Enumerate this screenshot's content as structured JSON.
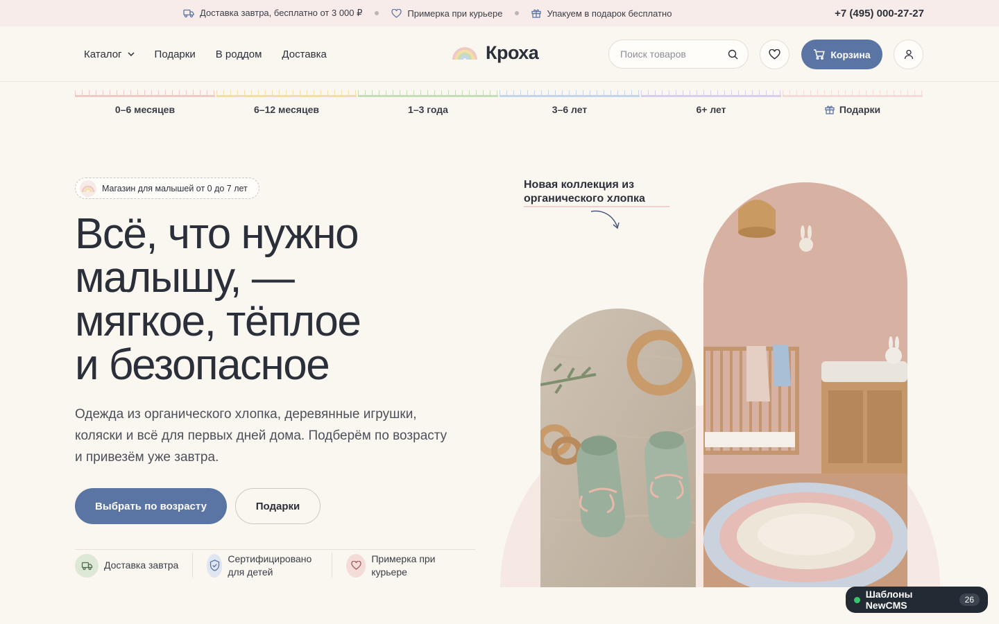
{
  "topbar": {
    "items": [
      {
        "icon": "truck-icon",
        "text": "Доставка завтра, бесплатно от 3 000 ₽"
      },
      {
        "icon": "heart-icon",
        "text": "Примерка при курьере"
      },
      {
        "icon": "gift-icon",
        "text": "Упакуем в подарок бесплатно"
      }
    ],
    "phone": "+7 (495) 000-27-27"
  },
  "header": {
    "nav": [
      {
        "label": "Каталог",
        "has_dropdown": true
      },
      {
        "label": "Подарки"
      },
      {
        "label": "В роддом"
      },
      {
        "label": "Доставка"
      }
    ],
    "logo_text": "Кроха",
    "search_placeholder": "Поиск товаров",
    "cart_label": "Корзина"
  },
  "age_ruler": [
    {
      "label": "0–6 месяцев",
      "color": "#efc9c4"
    },
    {
      "label": "6–12 месяцев",
      "color": "#f1dfa6"
    },
    {
      "label": "1–3 года",
      "color": "#c5dcb8"
    },
    {
      "label": "3–6 лет",
      "color": "#c4d5ea"
    },
    {
      "label": "6+ лет",
      "color": "#d8cdea"
    },
    {
      "label": "Подарки",
      "color": "#f3dcd7",
      "icon": "gift-icon"
    }
  ],
  "hero": {
    "badge": "Магазин для малышей от 0 до 7 лет",
    "title_lines": [
      "Всё, что нужно",
      "малышу, —",
      "мягкое, тёплое",
      "и безопасное"
    ],
    "subtitle": "Одежда из органического хлопка, деревянные игрушки, коляски и всё для первых дней дома. Подберём по возрасту и привезём уже завтра.",
    "primary_button": "Выбрать по возрасту",
    "secondary_button": "Подарки",
    "features": [
      {
        "icon": "truck-icon",
        "text": "Доставка завтра",
        "color": "#dde8d6"
      },
      {
        "icon": "shield-check-icon",
        "text": "Сертифицировано для детей",
        "color": "#dfe6f1"
      },
      {
        "icon": "heart-icon",
        "text": "Примерка при курьере",
        "color": "#f4dcd8"
      }
    ],
    "collage_note": "Новая коллекция из органического хлопка"
  },
  "widget": {
    "label": "Шаблоны NewCMS",
    "count": "26"
  },
  "colors": {
    "accent": "#5a74a3",
    "text": "#2b2f3a",
    "background": "#faf6f0",
    "topbar": "#f8ecea"
  }
}
